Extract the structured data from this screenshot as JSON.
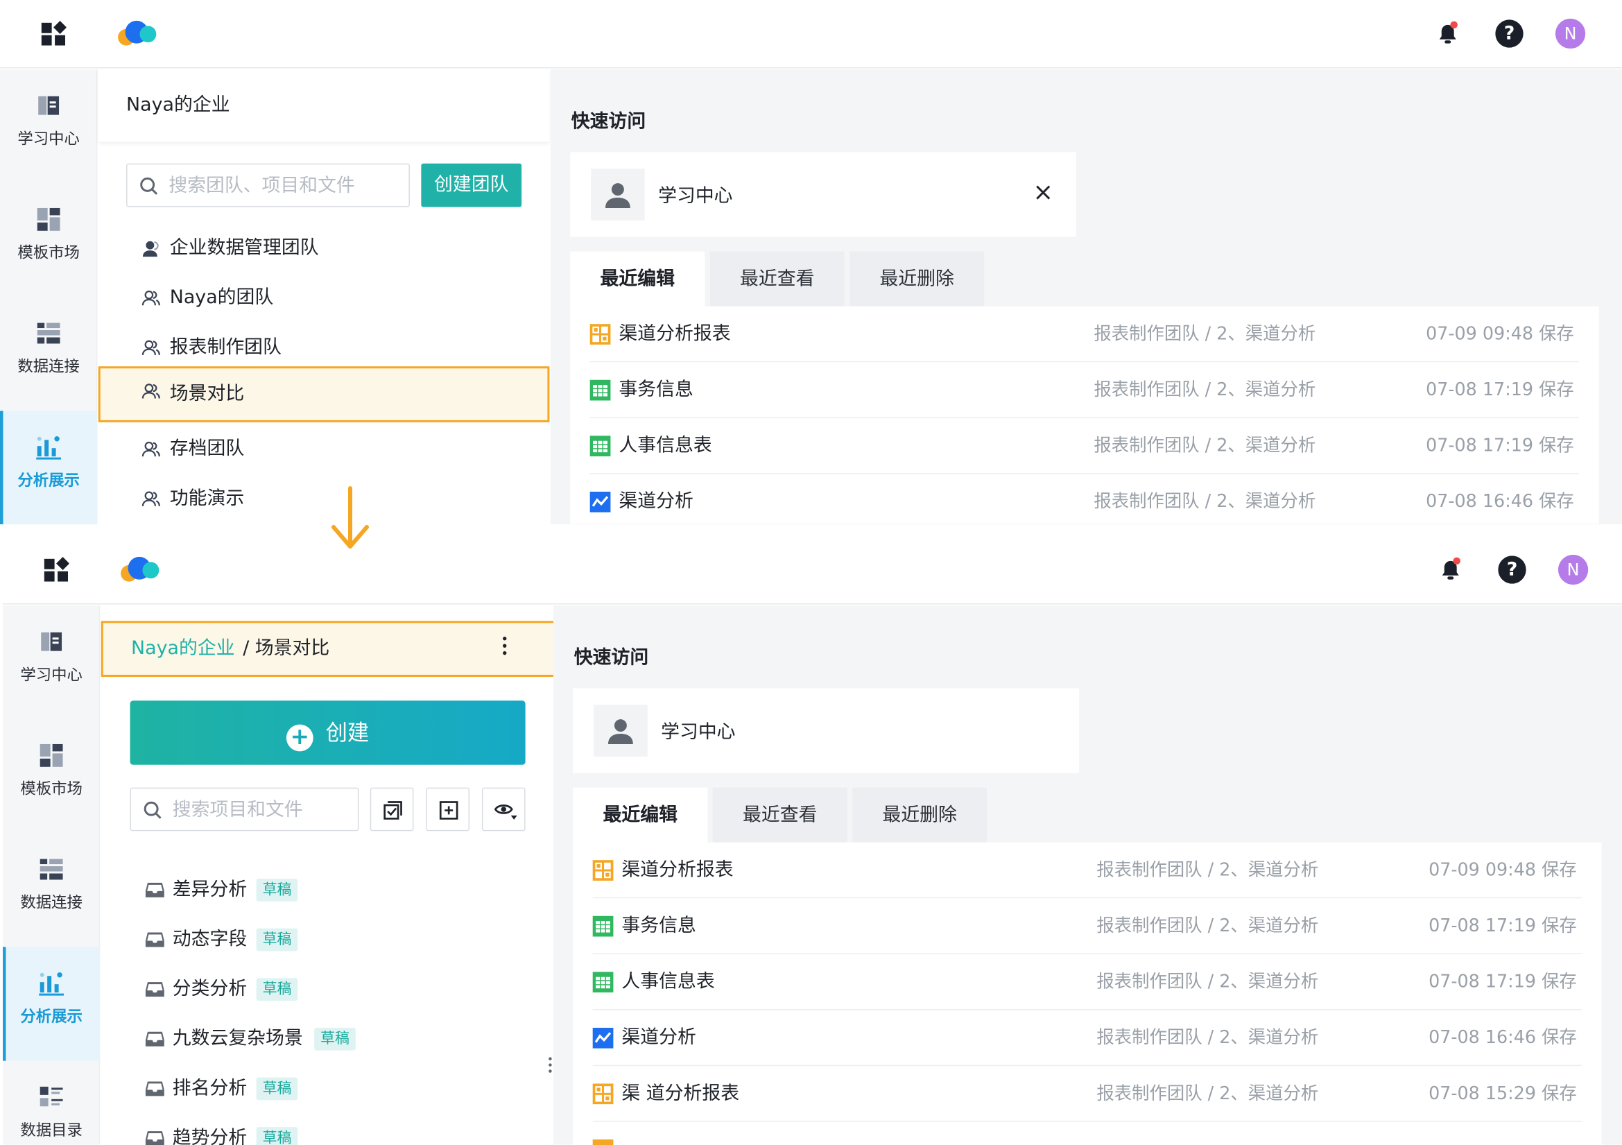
{
  "colors": {
    "accent": "#20b2a8",
    "highlight_border": "#f5a623",
    "active_rail": "#1b9bd6",
    "avatar": "#b57ce9"
  },
  "header": {
    "avatar_letter": "N",
    "help_glyph": "?"
  },
  "rail": {
    "items": [
      {
        "label": "学习中心",
        "icon": "book-icon"
      },
      {
        "label": "模板市场",
        "icon": "template-icon"
      },
      {
        "label": "数据连接",
        "icon": "database-icon"
      },
      {
        "label": "分析展示",
        "icon": "chart-icon",
        "active": true
      },
      {
        "label": "数据目录",
        "icon": "catalog-icon"
      }
    ]
  },
  "panel1": {
    "org_name": "Naya的企业",
    "search_placeholder": "搜索团队、项目和文件",
    "create_team": "创建团队",
    "teams": [
      "企业数据管理团队",
      "Naya的团队",
      "报表制作团队",
      "场景对比",
      "存档团队",
      "功能演示"
    ]
  },
  "panel2": {
    "breadcrumb_root": "Naya的企业",
    "breadcrumb_current": "/ 场景对比",
    "create_label": "创建",
    "search_placeholder": "搜索项目和文件",
    "draft_badge": "草稿",
    "projects": [
      "差异分析",
      "动态字段",
      "分类分析",
      "九数云复杂场景",
      "排名分析",
      "趋势分析"
    ]
  },
  "content": {
    "quick_access_title": "快速访问",
    "quick_access_item": "学习中心",
    "tabs": [
      "最近编辑",
      "最近查看",
      "最近删除"
    ],
    "files": [
      {
        "name": "渠道分析报表",
        "type": "dashboard",
        "path": "报表制作团队 / 2、渠道分析",
        "time": "07-09 09:48 保存"
      },
      {
        "name": "事务信息",
        "type": "table",
        "path": "报表制作团队 / 2、渠道分析",
        "time": "07-08 17:19 保存"
      },
      {
        "name": "人事信息表",
        "type": "table",
        "path": "报表制作团队 / 2、渠道分析",
        "time": "07-08 17:19 保存"
      },
      {
        "name": "渠道分析",
        "type": "chart",
        "path": "报表制作团队 / 2、渠道分析",
        "time": "07-08 16:46 保存"
      },
      {
        "name": "渠 道分析报表",
        "type": "dashboard",
        "path": "报表制作团队 / 2、渠道分析",
        "time": "07-08 15:29 保存"
      }
    ]
  }
}
